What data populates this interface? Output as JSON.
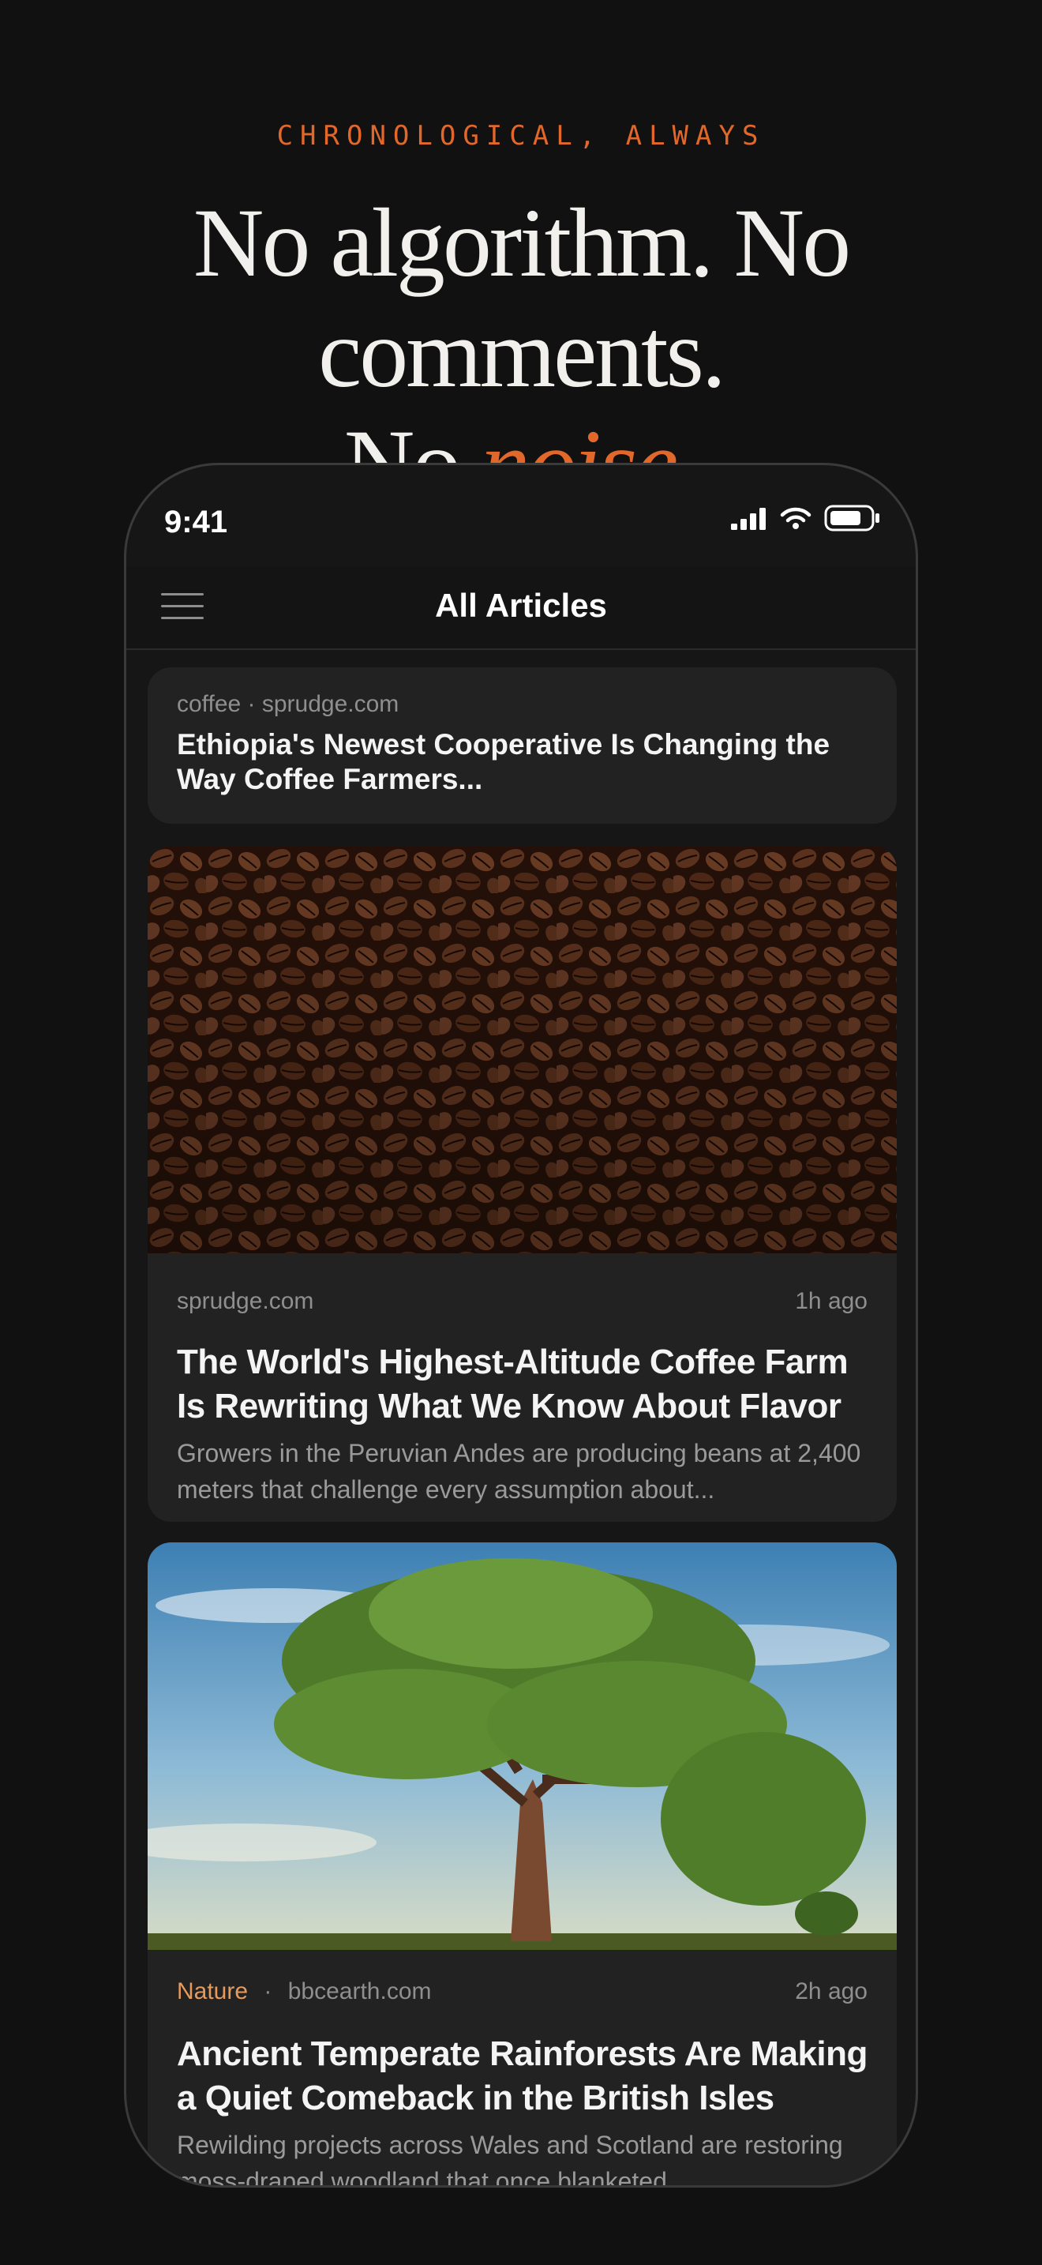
{
  "hero": {
    "eyebrow": "CHRONOLOGICAL, ALWAYS",
    "line1": "No algorithm. No comments.",
    "line2_plain": "No ",
    "line2_accent": "noise.",
    "accent_color": "#e2672a"
  },
  "phone": {
    "status": {
      "time": "9:41"
    },
    "nav": {
      "title": "All Articles"
    },
    "articles": [
      {
        "meta": "coffee · sprudge.com",
        "title": "Ethiopia's Newest Cooperative Is Changing the Way Coffee Farmers..."
      },
      {
        "image": "coffee-beans-photo",
        "source": "sprudge.com",
        "time": "1h ago",
        "title": "The World's Highest-Altitude Coffee Farm Is Rewriting What We Know About Flavor",
        "excerpt": "Growers in the Peruvian Andes are producing beans at 2,400 meters that challenge every assumption about..."
      },
      {
        "image": "tree-landscape-photo",
        "category": "Nature",
        "separator": "·",
        "source": "bbcearth.com",
        "time": "2h ago",
        "title": "Ancient Temperate Rainforests Are Making a Quiet Comeback in the British Isles",
        "excerpt": "Rewilding projects across Wales and Scotland are restoring moss-draped woodland that once blanketed..."
      }
    ]
  }
}
